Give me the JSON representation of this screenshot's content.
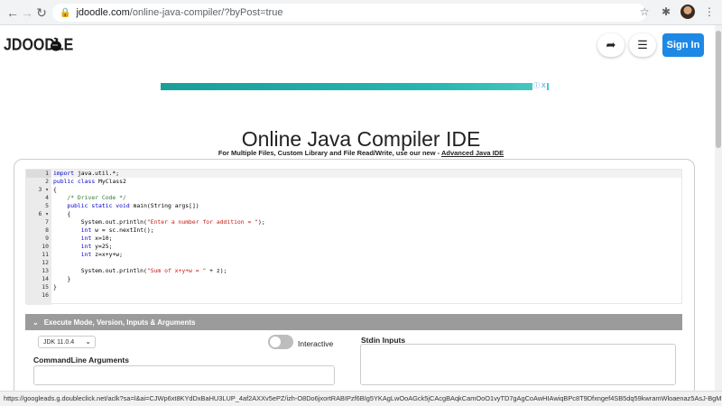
{
  "browser": {
    "url_domain": "jdoodle.com",
    "url_path": "/online-java-compiler/?byPost=true",
    "back_icon": "arrow-left",
    "forward_icon": "arrow-right",
    "reload_icon": "reload"
  },
  "header": {
    "logo_text": "JDOODLE",
    "share_icon": "share-arrow",
    "menu_icon": "hamburger",
    "signin_label": "Sign In"
  },
  "ad": {
    "close_label": "ⓘ X"
  },
  "page": {
    "title": "Online Java Compiler IDE",
    "subtitle_prefix": "For Multiple Files, Custom Library and File Read/Write, use our new - ",
    "subtitle_link": "Advanced Java IDE"
  },
  "editor": {
    "lines": [
      {
        "num": "1",
        "fold": "",
        "text": "import java.util.*;"
      },
      {
        "num": "2",
        "fold": "",
        "text": "public class MyClass2"
      },
      {
        "num": "3",
        "fold": "▾",
        "text": "{"
      },
      {
        "num": "4",
        "fold": "",
        "text": "    /* Driver Code */"
      },
      {
        "num": "5",
        "fold": "",
        "text": "    public static void main(String args[])"
      },
      {
        "num": "6",
        "fold": "▾",
        "text": "    {"
      },
      {
        "num": "7",
        "fold": "",
        "text": "        System.out.println(\"Enter a number for addition = \");"
      },
      {
        "num": "8",
        "fold": "",
        "text": "        int w = sc.nextInt();"
      },
      {
        "num": "9",
        "fold": "",
        "text": "        int x=10;"
      },
      {
        "num": "10",
        "fold": "",
        "text": "        int y=25;"
      },
      {
        "num": "11",
        "fold": "",
        "text": "        int z=x+y+w;"
      },
      {
        "num": "12",
        "fold": "",
        "text": ""
      },
      {
        "num": "13",
        "fold": "",
        "text": "        System.out.println(\"Sum of x+y+w = \" + z);"
      },
      {
        "num": "14",
        "fold": "",
        "text": "    }"
      },
      {
        "num": "15",
        "fold": "",
        "text": "}"
      },
      {
        "num": "16",
        "fold": "",
        "text": ""
      }
    ]
  },
  "execute": {
    "bar_label": "Execute Mode, Version, Inputs & Arguments",
    "jdk_value": "JDK 11.0.4",
    "interactive_label": "Interactive",
    "stdin_label": "Stdin Inputs",
    "cmd_label": "CommandLine Arguments"
  },
  "status": {
    "url": "https://googleads.g.doubleclick.net/aclk?sa=l&ai=CJWp6xt8KYdDxBaHU3LUP_4af2AXXv5ePZ/izh-O8Do6jxortRABIPzf6BIg5YKAgLwOoAGck5jCAcgBAqkCamOoO1vyTD7gAgCoAwHIAwiqBPc8T9Dfxngef4SB5dq59kwramWloaenaz5AsJ-BgMNuoWo7aT..."
  }
}
